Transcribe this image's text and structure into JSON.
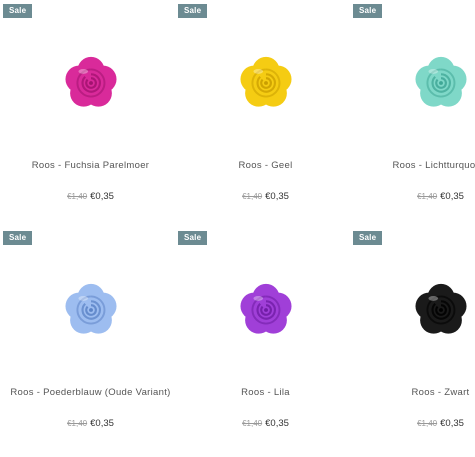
{
  "products": [
    {
      "badge": "Sale",
      "name": "Roos - Fuchsia Parelmoer",
      "old_price": "€1,40",
      "price": "€0,35",
      "color": "#d92a9a",
      "dark": "#a1126f"
    },
    {
      "badge": "Sale",
      "name": "Roos - Geel",
      "old_price": "€1,40",
      "price": "€0,35",
      "color": "#f5cc13",
      "dark": "#c99e00"
    },
    {
      "badge": "Sale",
      "name": "Roos - Lichtturquoise",
      "old_price": "€1,40",
      "price": "€0,35",
      "color": "#7fd8c8",
      "dark": "#3fa796"
    },
    {
      "badge": "Sale",
      "name": "Roos - Poederblauw (Oude Variant)",
      "old_price": "€1,40",
      "price": "€0,35",
      "color": "#9dbdf0",
      "dark": "#5c84c7"
    },
    {
      "badge": "Sale",
      "name": "Roos - Lila",
      "old_price": "€1,40",
      "price": "€0,35",
      "color": "#a03fd8",
      "dark": "#6e1ba3"
    },
    {
      "badge": "Sale",
      "name": "Roos - Zwart",
      "old_price": "€1,40",
      "price": "€0,35",
      "color": "#1a1a1a",
      "dark": "#000000"
    }
  ]
}
